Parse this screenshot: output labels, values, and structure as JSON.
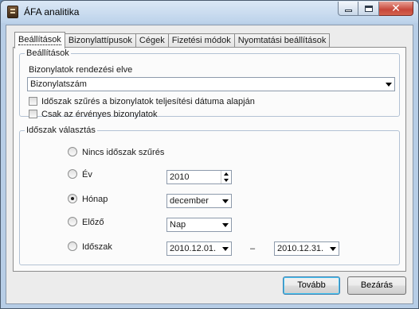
{
  "window": {
    "title": "ÁFA analitika"
  },
  "tabs": [
    {
      "label": "Beállítások",
      "active": true
    },
    {
      "label": "Bizonylattípusok",
      "active": false
    },
    {
      "label": "Cégek",
      "active": false
    },
    {
      "label": "Fizetési módok",
      "active": false
    },
    {
      "label": "Nyomtatási beállítások",
      "active": false
    }
  ],
  "settings_group": {
    "title": "Beállítások",
    "sort_label": "Bizonylatok rendezési elve",
    "sort_value": "Bizonylatszám",
    "checkbox_period_filter": {
      "label": "Időszak szűrés a bizonylatok teljesítési dátuma alapján",
      "checked": false
    },
    "checkbox_valid_only": {
      "label": "Csak az érvényes bizonylatok",
      "checked": false
    }
  },
  "period_group": {
    "title": "Időszak választás",
    "options": {
      "none": {
        "label": "Nincs időszak szűrés",
        "selected": false
      },
      "year": {
        "label": "Év",
        "selected": false,
        "value": "2010"
      },
      "month": {
        "label": "Hónap",
        "selected": true,
        "value": "december"
      },
      "previous": {
        "label": "Előző",
        "selected": false,
        "value": "Nap"
      },
      "range": {
        "label": "Időszak",
        "selected": false,
        "from": "2010.12.01.",
        "separator": "–",
        "to": "2010.12.31."
      }
    }
  },
  "buttons": {
    "next": "Tovább",
    "close": "Bezárás"
  }
}
